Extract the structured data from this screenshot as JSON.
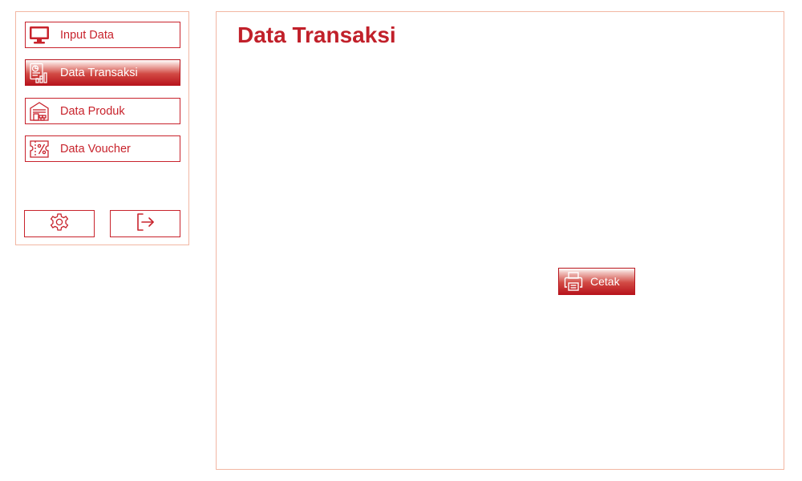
{
  "colors": {
    "accent": "#c8232c",
    "title": "#c1202a",
    "panel_border": "#f2b7a3"
  },
  "sidebar": {
    "items": [
      {
        "label": "Input Data",
        "icon": "monitor-icon",
        "active": false
      },
      {
        "label": "Data Transaksi",
        "icon": "report-chart-icon",
        "active": true
      },
      {
        "label": "Data Produk",
        "icon": "warehouse-icon",
        "active": false
      },
      {
        "label": "Data Voucher",
        "icon": "voucher-icon",
        "active": false
      }
    ],
    "settings_icon": "gear-icon",
    "logout_icon": "logout-icon"
  },
  "main": {
    "title": "Data Transaksi",
    "print_button": {
      "label": "Cetak",
      "icon": "printer-icon"
    }
  }
}
